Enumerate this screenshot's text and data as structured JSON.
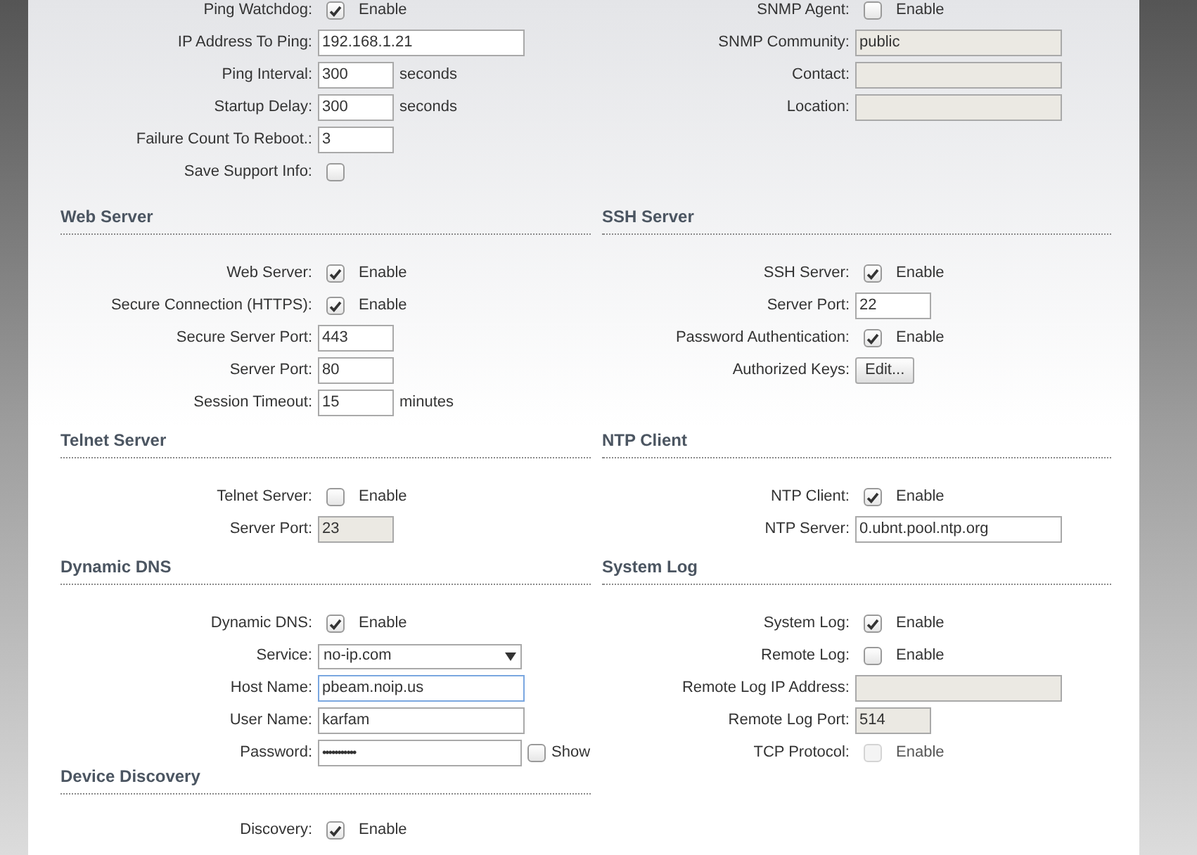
{
  "bands": [
    {
      "columns": [
        [
          {
            "rows": [
              {
                "kind": "checkbox",
                "label": "Ping Watchdog:",
                "checked": true,
                "disabled": false,
                "option": "Enable"
              },
              {
                "kind": "text",
                "label": "IP Address To Ping:",
                "value": "192.168.1.21",
                "disabled": false
              },
              {
                "kind": "number",
                "label": "Ping Interval:",
                "value": "300",
                "disabled": false,
                "suffix": "seconds"
              },
              {
                "kind": "number",
                "label": "Startup Delay:",
                "value": "300",
                "disabled": false,
                "suffix": "seconds"
              },
              {
                "kind": "number",
                "label": "Failure Count To Reboot.:",
                "value": "3",
                "disabled": false
              },
              {
                "kind": "checkbox",
                "label": "Save Support Info:",
                "checked": false,
                "disabled": false
              }
            ]
          }
        ],
        [
          {
            "rows": [
              {
                "kind": "checkbox",
                "label": "SNMP Agent:",
                "checked": false,
                "disabled": false,
                "option": "Enable"
              },
              {
                "kind": "text",
                "label": "SNMP Community:",
                "value": "public",
                "disabled": true
              },
              {
                "kind": "text",
                "label": "Contact:",
                "disabled": true
              },
              {
                "kind": "text",
                "label": "Location:",
                "disabled": true
              }
            ]
          }
        ]
      ]
    },
    {
      "columns": [
        [
          {
            "title": "Web Server",
            "rows": [
              {
                "kind": "checkbox",
                "label": "Web Server:",
                "checked": true,
                "disabled": false,
                "option": "Enable"
              },
              {
                "kind": "checkbox",
                "label": "Secure Connection (HTTPS):",
                "checked": true,
                "disabled": false,
                "option": "Enable"
              },
              {
                "kind": "number",
                "label": "Secure Server Port:",
                "value": "443",
                "disabled": false
              },
              {
                "kind": "number",
                "label": "Server Port:",
                "value": "80",
                "disabled": false
              },
              {
                "kind": "number",
                "label": "Session Timeout:",
                "value": "15",
                "disabled": false,
                "suffix": "minutes"
              }
            ]
          }
        ],
        [
          {
            "title": "SSH Server",
            "rows": [
              {
                "kind": "checkbox",
                "label": "SSH Server:",
                "checked": true,
                "disabled": false,
                "option": "Enable"
              },
              {
                "kind": "number",
                "label": "Server Port:",
                "value": "22",
                "disabled": false
              },
              {
                "kind": "checkbox",
                "label": "Password Authentication:",
                "checked": true,
                "disabled": false,
                "option": "Enable"
              },
              {
                "kind": "button",
                "label": "Authorized Keys:",
                "button": "Edit..."
              }
            ]
          }
        ]
      ]
    },
    {
      "columns": [
        [
          {
            "title": "Telnet Server",
            "rows": [
              {
                "kind": "checkbox",
                "label": "Telnet Server:",
                "checked": false,
                "disabled": false,
                "option": "Enable"
              },
              {
                "kind": "number",
                "label": "Server Port:",
                "value": "23",
                "disabled": true
              }
            ]
          }
        ],
        [
          {
            "title": "NTP Client",
            "rows": [
              {
                "kind": "checkbox",
                "label": "NTP Client:",
                "checked": true,
                "disabled": false,
                "option": "Enable"
              },
              {
                "kind": "text",
                "label": "NTP Server:",
                "value": "0.ubnt.pool.ntp.org",
                "disabled": false
              }
            ]
          }
        ]
      ]
    },
    {
      "columns": [
        [
          {
            "title": "Dynamic DNS",
            "rows": [
              {
                "kind": "checkbox",
                "label": "Dynamic DNS:",
                "checked": true,
                "disabled": false,
                "option": "Enable"
              },
              {
                "kind": "select",
                "label": "Service:",
                "value": "no-ip.com"
              },
              {
                "kind": "text",
                "label": "Host Name:",
                "value": "pbeam.noip.us",
                "disabled": false,
                "focused": true
              },
              {
                "kind": "text",
                "label": "User Name:",
                "value": "karfam",
                "disabled": false
              },
              {
                "kind": "password",
                "label": "Password:",
                "value": "•••••••••••",
                "show": {
                  "label": "Show",
                  "checked": false
                }
              }
            ]
          },
          {
            "title": "Device Discovery",
            "rows": [
              {
                "kind": "checkbox",
                "label": "Discovery:",
                "checked": true,
                "disabled": false,
                "option": "Enable"
              }
            ]
          }
        ],
        [
          {
            "title": "System Log",
            "rows": [
              {
                "kind": "checkbox",
                "label": "System Log:",
                "checked": true,
                "disabled": false,
                "option": "Enable"
              },
              {
                "kind": "checkbox",
                "label": "Remote Log:",
                "checked": false,
                "disabled": false,
                "option": "Enable"
              },
              {
                "kind": "text",
                "label": "Remote Log IP Address:",
                "disabled": true
              },
              {
                "kind": "number",
                "label": "Remote Log Port:",
                "value": "514",
                "disabled": true
              },
              {
                "kind": "checkbox",
                "label": "TCP Protocol:",
                "checked": false,
                "disabled": true,
                "option": "Enable"
              }
            ]
          }
        ]
      ]
    }
  ]
}
